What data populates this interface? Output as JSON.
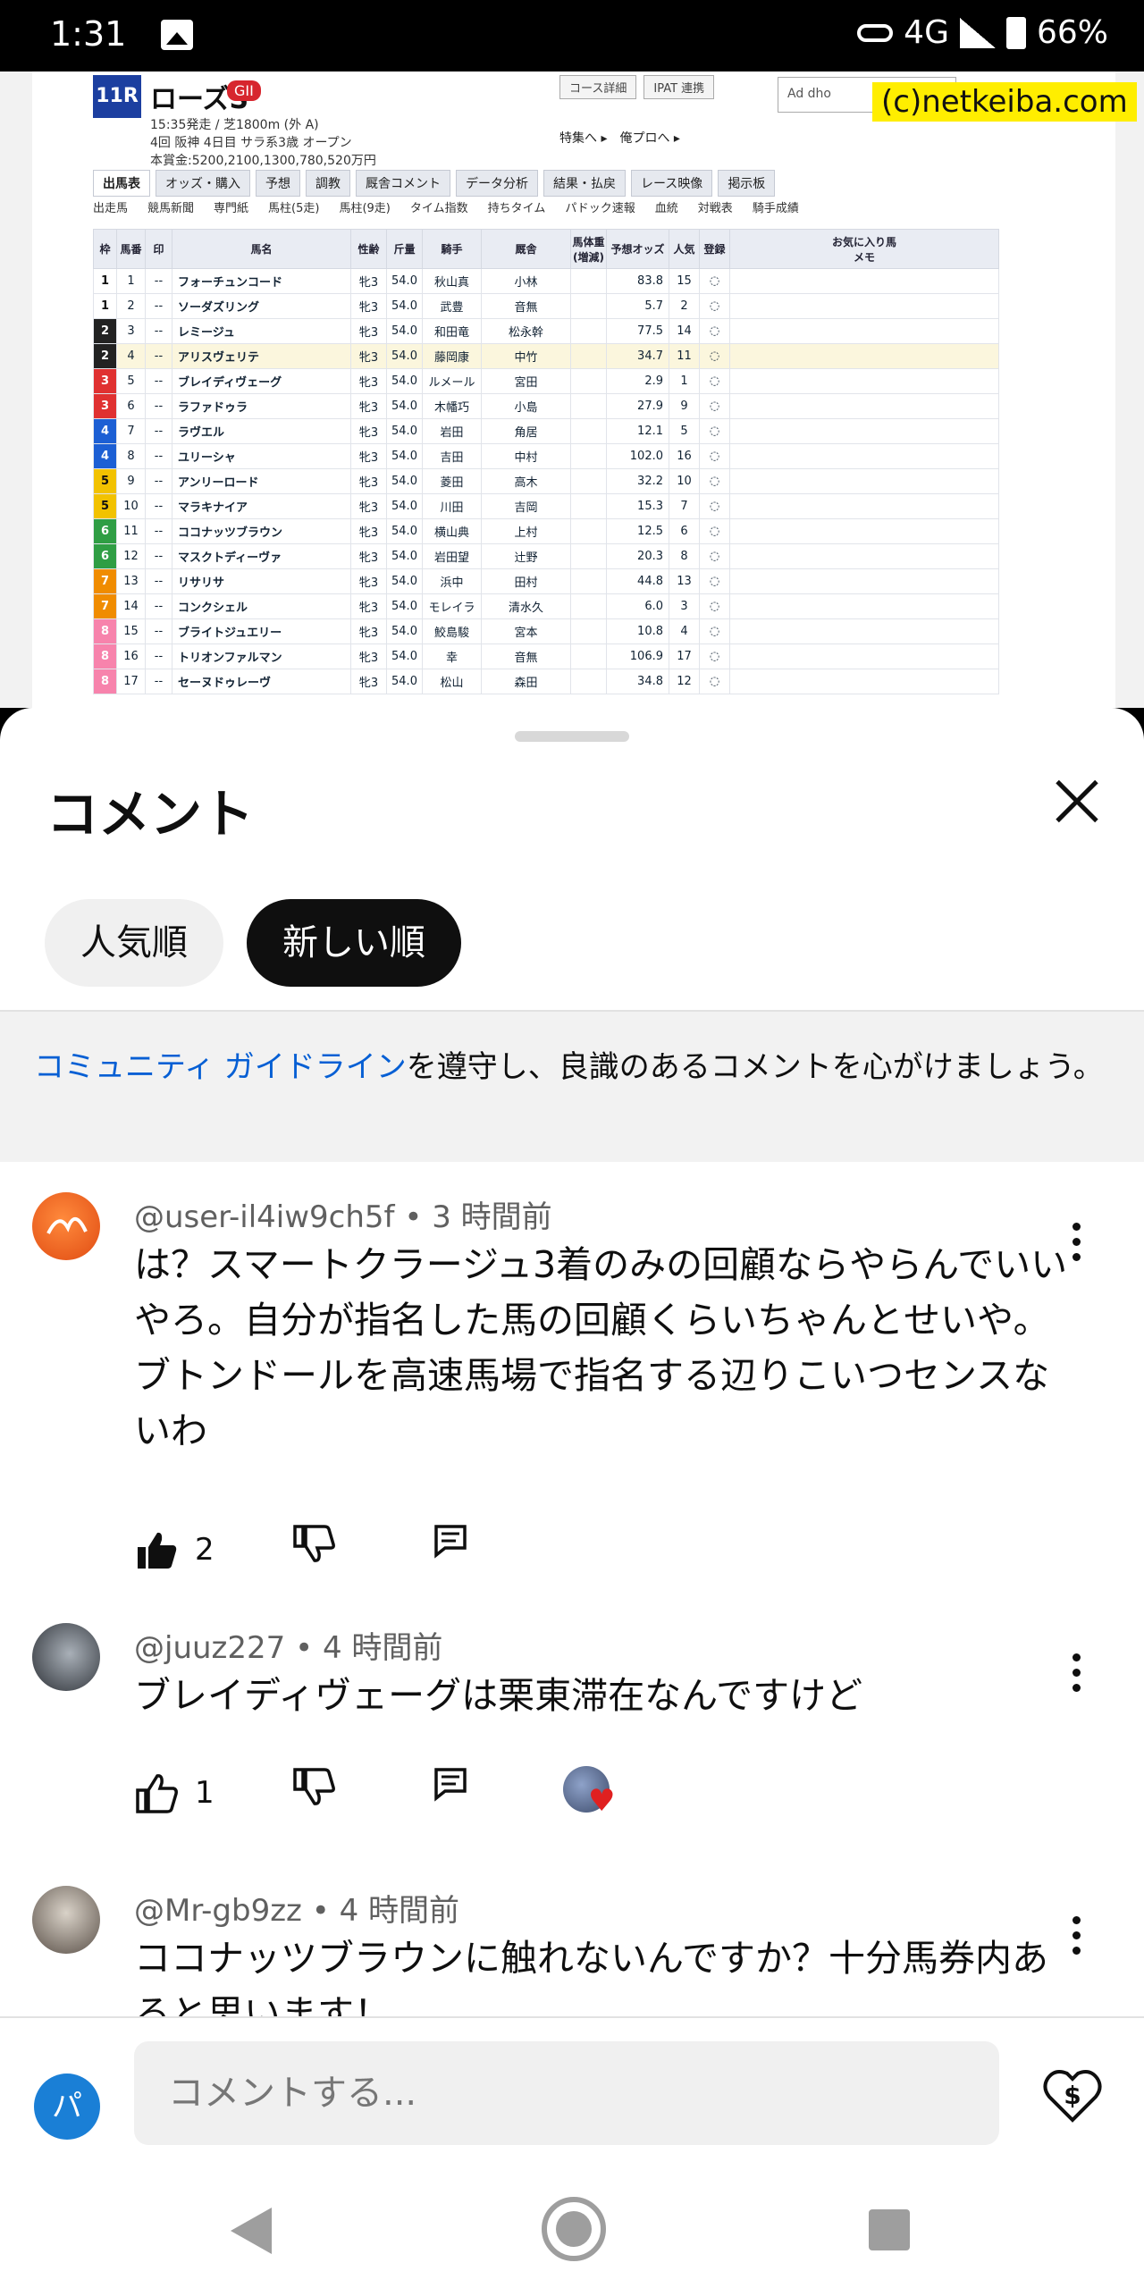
{
  "status_bar": {
    "time": "1:31",
    "network": "4G",
    "battery": "66%"
  },
  "video": {
    "race_no": "11R",
    "race_name": "ローズS",
    "grade": "GII",
    "info_line1": "15:35発走 / 芝1800m (外 A)",
    "info_line2": "4回 阪神 4日目 サラ系3歳 オープン",
    "info_line3": "本賞金:5200,2100,1300,780,520万円",
    "buttons": [
      "コース詳細",
      "IPAT 連携"
    ],
    "links": "特集へ ▸　俺プロへ ▸",
    "ad_text": "Ad dho",
    "watermark": "(c)netkeiba.com",
    "tabs": [
      "出馬表",
      "オッズ・購入",
      "予想",
      "調教",
      "厩舎コメント",
      "データ分析",
      "結果・払戻",
      "レース映像",
      "掲示板"
    ],
    "subtabs": [
      "出走馬",
      "競馬新聞",
      "専門紙",
      "馬柱(5走)",
      "馬柱(9走)",
      "タイム指数",
      "持ちタイム",
      "パドック速報",
      "血統",
      "対戦表",
      "騎手成績"
    ],
    "headers": [
      "枠",
      "馬番",
      "印",
      "馬名",
      "性齢",
      "斤量",
      "騎手",
      "厩舎",
      "馬体重(増減)",
      "予想オッズ",
      "人気",
      "登録",
      "メモ"
    ],
    "rows": [
      {
        "waku": "1",
        "uma": "1",
        "name": "フォーチュンコード",
        "sei": "牝3",
        "kin": "54.0",
        "jockey": "秋山真",
        "stable": "小林",
        "odds": "83.8",
        "pop": "15"
      },
      {
        "waku": "1",
        "uma": "2",
        "name": "ソーダズリング",
        "sei": "牝3",
        "kin": "54.0",
        "jockey": "武豊",
        "stable": "音無",
        "odds": "5.7",
        "pop": "2"
      },
      {
        "waku": "2",
        "uma": "3",
        "name": "レミージュ",
        "sei": "牝3",
        "kin": "54.0",
        "jockey": "和田竜",
        "stable": "松永幹",
        "odds": "77.5",
        "pop": "14"
      },
      {
        "waku": "2",
        "uma": "4",
        "name": "アリスヴェリテ",
        "sei": "牝3",
        "kin": "54.0",
        "jockey": "藤岡康",
        "stable": "中竹",
        "odds": "34.7",
        "pop": "11"
      },
      {
        "waku": "3",
        "uma": "5",
        "name": "ブレイディヴェーグ",
        "sei": "牝3",
        "kin": "54.0",
        "jockey": "ルメール",
        "stable": "宮田",
        "odds": "2.9",
        "pop": "1"
      },
      {
        "waku": "3",
        "uma": "6",
        "name": "ラファドゥラ",
        "sei": "牝3",
        "kin": "54.0",
        "jockey": "木幡巧",
        "stable": "小島",
        "odds": "27.9",
        "pop": "9"
      },
      {
        "waku": "4",
        "uma": "7",
        "name": "ラヴエル",
        "sei": "牝3",
        "kin": "54.0",
        "jockey": "岩田",
        "stable": "角居",
        "odds": "12.1",
        "pop": "5"
      },
      {
        "waku": "4",
        "uma": "8",
        "name": "ユリーシャ",
        "sei": "牝3",
        "kin": "54.0",
        "jockey": "吉田",
        "stable": "中村",
        "odds": "102.0",
        "pop": "16"
      },
      {
        "waku": "5",
        "uma": "9",
        "name": "アンリーロード",
        "sei": "牝3",
        "kin": "54.0",
        "jockey": "菱田",
        "stable": "高木",
        "odds": "32.2",
        "pop": "10"
      },
      {
        "waku": "5",
        "uma": "10",
        "name": "マラキナイア",
        "sei": "牝3",
        "kin": "54.0",
        "jockey": "川田",
        "stable": "吉岡",
        "odds": "15.3",
        "pop": "7"
      },
      {
        "waku": "6",
        "uma": "11",
        "name": "ココナッツブラウン",
        "sei": "牝3",
        "kin": "54.0",
        "jockey": "横山典",
        "stable": "上村",
        "odds": "12.5",
        "pop": "6"
      },
      {
        "waku": "6",
        "uma": "12",
        "name": "マスクトディーヴァ",
        "sei": "牝3",
        "kin": "54.0",
        "jockey": "岩田望",
        "stable": "辻野",
        "odds": "20.3",
        "pop": "8"
      },
      {
        "waku": "7",
        "uma": "13",
        "name": "リサリサ",
        "sei": "牝3",
        "kin": "54.0",
        "jockey": "浜中",
        "stable": "田村",
        "odds": "44.8",
        "pop": "13"
      },
      {
        "waku": "7",
        "uma": "14",
        "name": "コンクシェル",
        "sei": "牝3",
        "kin": "54.0",
        "jockey": "モレイラ",
        "stable": "清水久",
        "odds": "6.0",
        "pop": "3"
      },
      {
        "waku": "8",
        "uma": "15",
        "name": "ブライトジュエリー",
        "sei": "牝3",
        "kin": "54.0",
        "jockey": "鮫島駿",
        "stable": "宮本",
        "odds": "10.8",
        "pop": "4"
      },
      {
        "waku": "8",
        "uma": "16",
        "name": "トリオンファルマン",
        "sei": "牝3",
        "kin": "54.0",
        "jockey": "幸",
        "stable": "音無",
        "odds": "106.9",
        "pop": "17"
      },
      {
        "waku": "8",
        "uma": "17",
        "name": "セーヌドゥレーヴ",
        "sei": "牝3",
        "kin": "54.0",
        "jockey": "松山",
        "stable": "森田",
        "odds": "34.8",
        "pop": "12"
      }
    ],
    "fav_header": "お気に入り馬"
  },
  "sheet": {
    "title": "コメント",
    "chips": [
      "人気順",
      "新しい順"
    ],
    "guideline_link": "コミュニティ ガイドライン",
    "guideline_text": "を遵守し、良識のあるコメントを心がけましょう。"
  },
  "comments": [
    {
      "author": "@user-il4iw9ch5f",
      "time": "3 時間前",
      "text": "は？スマートクラージュ3着のみの回顧ならやらんでいいやろ。自分が指名した馬の回顧くらいちゃんとせいや。ブトンドールを高速馬場で指名する辺りこいつセンスないわ",
      "likes": "2"
    },
    {
      "author": "@juuz227",
      "time": "4 時間前",
      "text": "ブレイディヴェーグは栗東滞在なんですけど",
      "likes": "1"
    },
    {
      "author": "@Mr-gb9zz",
      "time": "4 時間前",
      "text": "ココナッツブラウンに触れないんですか？十分馬券内あると思います！",
      "likes": ""
    }
  ],
  "input": {
    "placeholder": "コメントする...",
    "user_initial": "パ"
  },
  "colors": {
    "accent_link": "#065fd4",
    "chip_active": "#0f0f0f",
    "guideline_bg": "#f2f2f2",
    "watermark_bg": "#ffee00"
  },
  "icons": [
    "image-icon",
    "vpn-key-icon",
    "signal-icon",
    "battery-icon",
    "close-icon",
    "like-icon",
    "dislike-icon",
    "reply-icon",
    "more-vert-icon",
    "thanks-icon",
    "back-icon",
    "home-icon",
    "recents-icon"
  ]
}
